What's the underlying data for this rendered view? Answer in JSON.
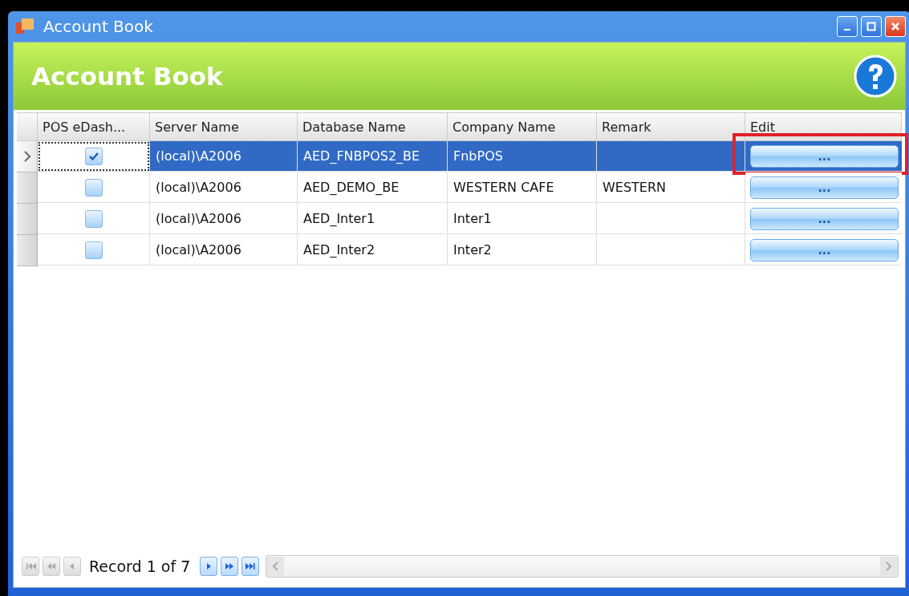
{
  "window": {
    "title": "Account Book"
  },
  "header": {
    "title": "Account Book"
  },
  "table": {
    "columns": [
      "POS eDash...",
      "Server Name",
      "Database Name",
      "Company Name",
      "Remark",
      "Edit"
    ],
    "rows": [
      {
        "current": true,
        "selected": true,
        "checked": true,
        "server": "(local)\\A2006",
        "database": "AED_FNBPOS2_BE",
        "company": "FnbPOS",
        "remark": "",
        "edit": "...",
        "highlighted": true
      },
      {
        "current": false,
        "selected": false,
        "checked": false,
        "server": "(local)\\A2006",
        "database": "AED_DEMO_BE",
        "company": "WESTERN CAFE",
        "remark": "WESTERN",
        "edit": "...",
        "highlighted": false
      },
      {
        "current": false,
        "selected": false,
        "checked": false,
        "server": "(local)\\A2006",
        "database": "AED_Inter1",
        "company": "Inter1",
        "remark": "",
        "edit": "...",
        "highlighted": false
      },
      {
        "current": false,
        "selected": false,
        "checked": false,
        "server": "(local)\\A2006",
        "database": "AED_Inter2",
        "company": "Inter2",
        "remark": "",
        "edit": "...",
        "highlighted": false
      }
    ]
  },
  "navigator": {
    "record": "Record 1 of 7",
    "buttons_before": [
      {
        "kind": "first",
        "disabled": true
      },
      {
        "kind": "prev-page",
        "disabled": true
      },
      {
        "kind": "prev",
        "disabled": true
      }
    ],
    "buttons_after": [
      {
        "kind": "next",
        "disabled": false
      },
      {
        "kind": "next-page",
        "disabled": false
      },
      {
        "kind": "last",
        "disabled": false
      }
    ]
  }
}
